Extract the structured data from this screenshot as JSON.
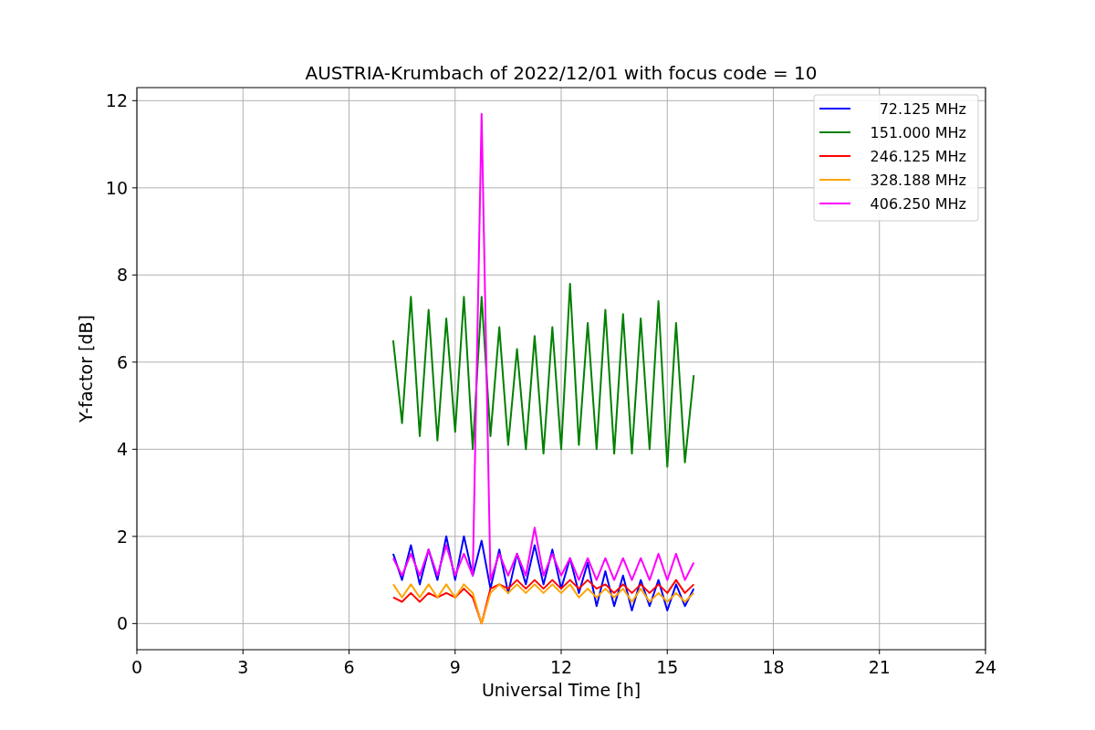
{
  "chart_data": {
    "type": "line",
    "title": "AUSTRIA-Krumbach of 2022/12/01 with focus code = 10",
    "xlabel": "Universal Time [h]",
    "ylabel": "Y-factor [dB]",
    "x": [
      7.25,
      7.5,
      7.75,
      8,
      8.25,
      8.5,
      8.75,
      9,
      9.25,
      9.5,
      9.75,
      10,
      10.25,
      10.5,
      10.75,
      11,
      11.25,
      11.5,
      11.75,
      12,
      12.25,
      12.5,
      12.75,
      13,
      13.25,
      13.5,
      13.75,
      14,
      14.25,
      14.5,
      14.75,
      15,
      15.25,
      15.5,
      15.75
    ],
    "series": [
      {
        "name": "72.125 MHz",
        "color": "#0000ff",
        "values": [
          1.6,
          1.0,
          1.8,
          0.9,
          1.7,
          1.0,
          2.0,
          1.0,
          2.0,
          1.1,
          1.9,
          0.8,
          1.7,
          0.7,
          1.6,
          0.9,
          1.8,
          0.9,
          1.7,
          0.8,
          1.5,
          0.7,
          1.4,
          0.4,
          1.2,
          0.4,
          1.1,
          0.3,
          1.0,
          0.4,
          1.0,
          0.3,
          0.9,
          0.4,
          0.8
        ]
      },
      {
        "name": "151.000 MHz",
        "color": "#008000",
        "values": [
          6.5,
          4.6,
          7.5,
          4.3,
          7.2,
          4.2,
          7.0,
          4.4,
          7.5,
          4.0,
          7.5,
          4.3,
          6.8,
          4.1,
          6.3,
          4.0,
          6.6,
          3.9,
          6.8,
          4.0,
          7.8,
          4.1,
          6.9,
          4.0,
          7.2,
          3.9,
          7.1,
          3.9,
          7.0,
          4.0,
          7.4,
          3.6,
          6.9,
          3.7,
          5.7
        ]
      },
      {
        "name": "246.125 MHz",
        "color": "#ff0000",
        "values": [
          0.6,
          0.5,
          0.7,
          0.5,
          0.7,
          0.6,
          0.7,
          0.6,
          0.8,
          0.6,
          0.0,
          0.8,
          0.9,
          0.8,
          1.0,
          0.8,
          1.0,
          0.8,
          1.0,
          0.8,
          1.0,
          0.8,
          1.0,
          0.8,
          0.9,
          0.7,
          0.9,
          0.7,
          0.9,
          0.7,
          0.9,
          0.7,
          1.0,
          0.7,
          0.9
        ]
      },
      {
        "name": "328.188 MHz",
        "color": "#ffa500",
        "values": [
          0.9,
          0.6,
          0.9,
          0.6,
          0.9,
          0.6,
          0.9,
          0.6,
          0.9,
          0.7,
          0.0,
          0.7,
          0.9,
          0.7,
          0.9,
          0.7,
          0.9,
          0.7,
          0.9,
          0.7,
          0.9,
          0.6,
          0.8,
          0.6,
          0.8,
          0.6,
          0.8,
          0.5,
          0.8,
          0.5,
          0.7,
          0.5,
          0.7,
          0.5,
          0.7
        ]
      },
      {
        "name": "406.250 MHz",
        "color": "#ff00ff",
        "values": [
          1.5,
          1.1,
          1.6,
          1.1,
          1.7,
          1.1,
          1.8,
          1.1,
          1.6,
          1.1,
          11.7,
          1.0,
          1.6,
          1.1,
          1.6,
          1.1,
          2.2,
          1.1,
          1.6,
          1.1,
          1.5,
          1.0,
          1.5,
          1.0,
          1.5,
          1.0,
          1.5,
          1.0,
          1.5,
          1.0,
          1.6,
          1.0,
          1.6,
          1.0,
          1.4
        ]
      }
    ],
    "grid": true,
    "legend": true,
    "xlim": [
      0,
      24
    ],
    "ylim": [
      -0.6,
      12.3
    ],
    "xticks": [
      0,
      3,
      6,
      9,
      12,
      15,
      18,
      21,
      24
    ],
    "yticks": [
      0,
      2,
      4,
      6,
      8,
      10,
      12
    ]
  }
}
